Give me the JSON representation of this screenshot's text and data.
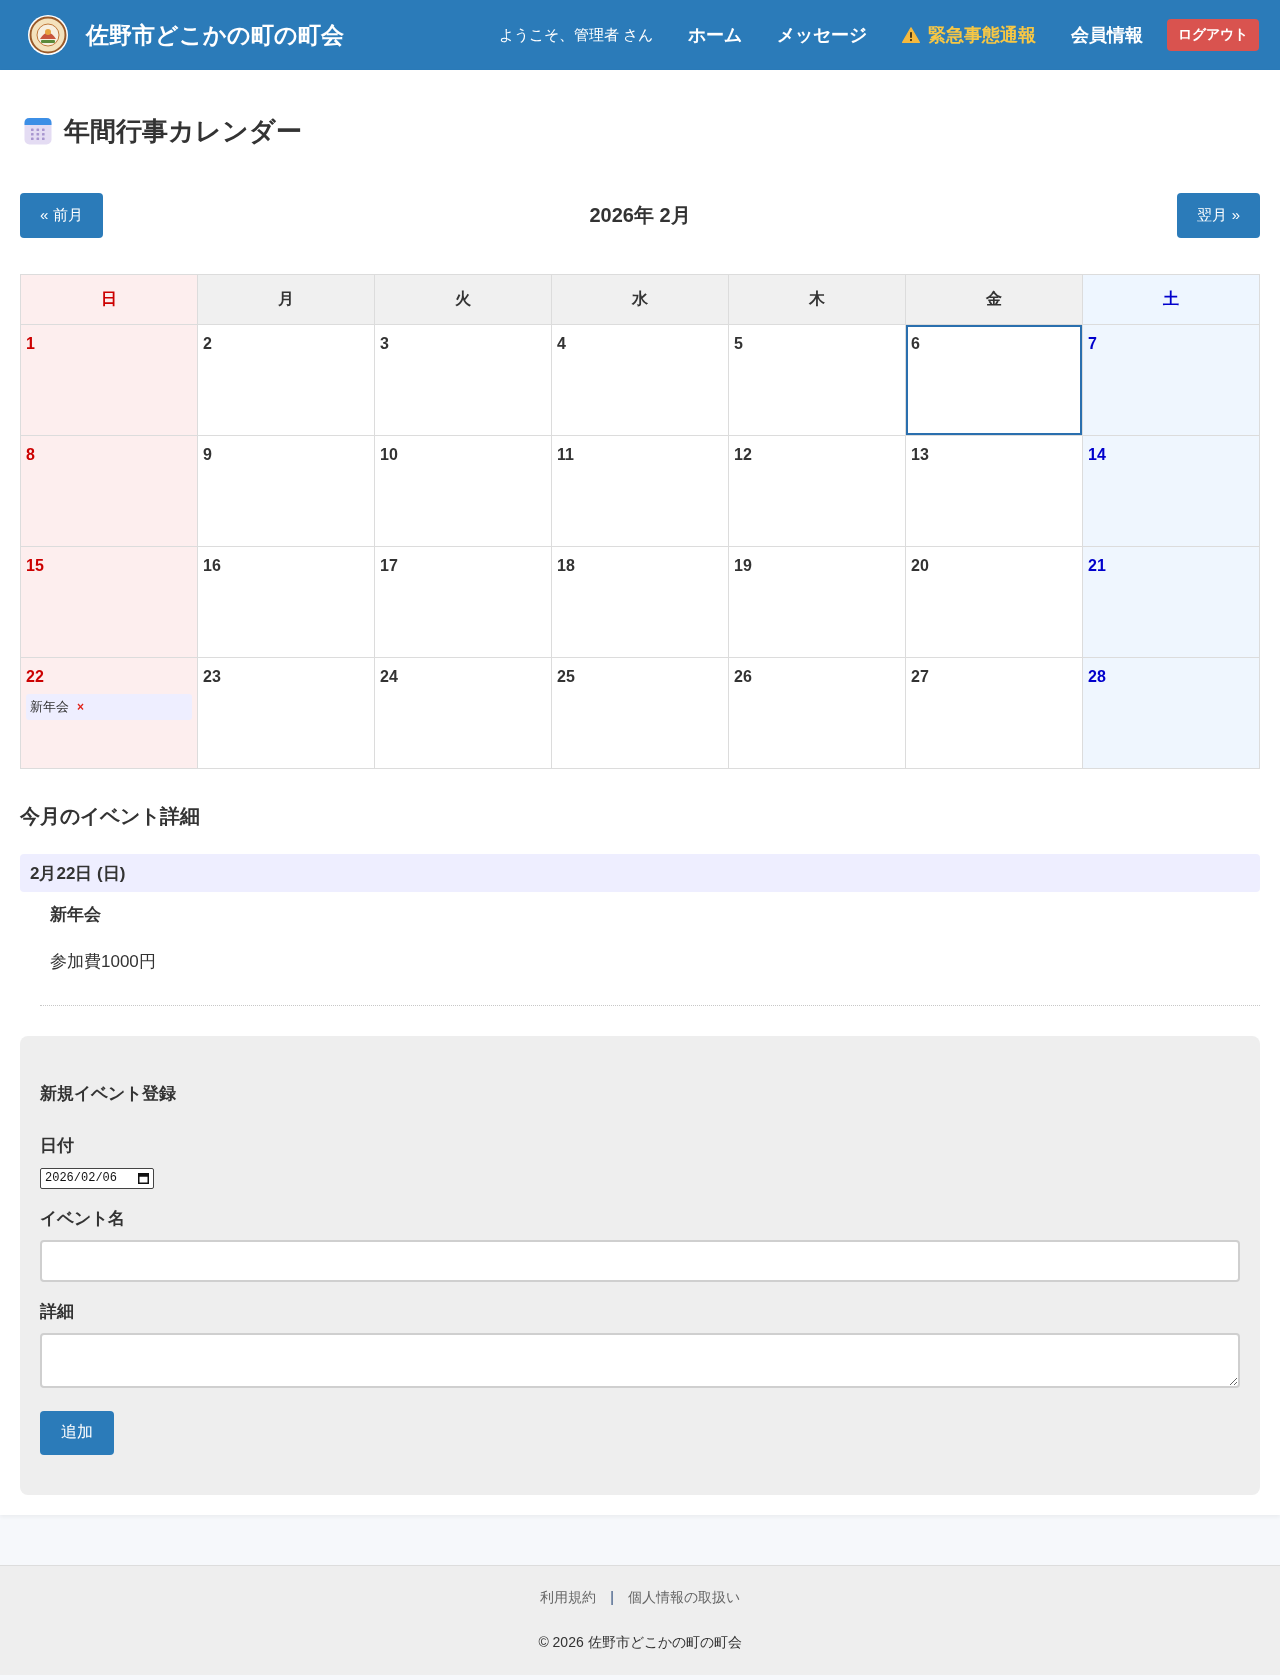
{
  "header": {
    "site_title": "佐野市どこかの町の町会",
    "welcome": "ようこそ、管理者 さん",
    "nav": [
      {
        "label": "ホーム",
        "kind": "link"
      },
      {
        "label": "メッセージ",
        "kind": "link"
      },
      {
        "label": "緊急事態通報",
        "kind": "alert"
      },
      {
        "label": "会員情報",
        "kind": "link"
      },
      {
        "label": "ログアウト",
        "kind": "button"
      }
    ]
  },
  "page_title": "年間行事カレンダー",
  "month_nav": {
    "prev": "« 前月",
    "current": "2026年 2月",
    "next": "翌月 »"
  },
  "calendar": {
    "weekdays": [
      {
        "label": "日",
        "kind": "sunday"
      },
      {
        "label": "月",
        "kind": "weekday"
      },
      {
        "label": "火",
        "kind": "weekday"
      },
      {
        "label": "水",
        "kind": "weekday"
      },
      {
        "label": "木",
        "kind": "weekday"
      },
      {
        "label": "金",
        "kind": "weekday"
      },
      {
        "label": "土",
        "kind": "saturday"
      }
    ],
    "weeks": [
      [
        {
          "day": "1",
          "today": false
        },
        {
          "day": "2",
          "today": false
        },
        {
          "day": "3",
          "today": false
        },
        {
          "day": "4",
          "today": false
        },
        {
          "day": "5",
          "today": false
        },
        {
          "day": "6",
          "today": true
        },
        {
          "day": "7",
          "today": false
        }
      ],
      [
        {
          "day": "8",
          "today": false
        },
        {
          "day": "9",
          "today": false
        },
        {
          "day": "10",
          "today": false
        },
        {
          "day": "11",
          "today": false
        },
        {
          "day": "12",
          "today": false
        },
        {
          "day": "13",
          "today": false
        },
        {
          "day": "14",
          "today": false
        }
      ],
      [
        {
          "day": "15",
          "today": false
        },
        {
          "day": "16",
          "today": false
        },
        {
          "day": "17",
          "today": false
        },
        {
          "day": "18",
          "today": false
        },
        {
          "day": "19",
          "today": false
        },
        {
          "day": "20",
          "today": false
        },
        {
          "day": "21",
          "today": false
        }
      ],
      [
        {
          "day": "22",
          "today": false,
          "events": [
            {
              "title": "新年会",
              "delete": "×"
            }
          ]
        },
        {
          "day": "23",
          "today": false
        },
        {
          "day": "24",
          "today": false
        },
        {
          "day": "25",
          "today": false
        },
        {
          "day": "26",
          "today": false
        },
        {
          "day": "27",
          "today": false
        },
        {
          "day": "28",
          "today": false
        }
      ]
    ]
  },
  "event_details": {
    "heading": "今月のイベント詳細",
    "groups": [
      {
        "date": "2月22日 (日)",
        "events": [
          {
            "title": "新年会",
            "description": "参加費1000円"
          }
        ]
      }
    ]
  },
  "new_event_form": {
    "heading": "新規イベント登録",
    "fields": [
      {
        "label": "日付",
        "kind": "date",
        "value": "2026/02/06"
      },
      {
        "label": "イベント名",
        "kind": "text"
      },
      {
        "label": "詳細",
        "kind": "textarea"
      }
    ],
    "submit": "追加"
  },
  "footer": {
    "links": [
      "利用規約",
      "個人情報の取扱い"
    ],
    "separator": "|",
    "copyright": "© 2026 佐野市どこかの町の町会"
  }
}
